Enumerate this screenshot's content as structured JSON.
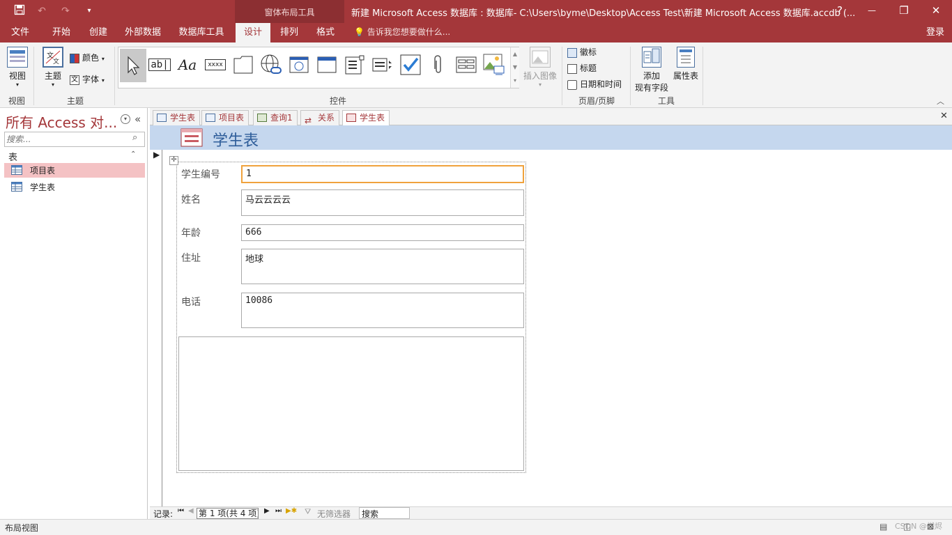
{
  "window": {
    "title": "新建 Microsoft Access 数据库 : 数据库- C:\\Users\\byme\\Desktop\\Access Test\\新建 Microsoft Access 数据库.accdb (...",
    "context_group": "窗体布局工具",
    "help": "?",
    "login": "登录",
    "minimize": "—",
    "restore": "❐",
    "close": "✕"
  },
  "ribbon_tabs": [
    "文件",
    "开始",
    "创建",
    "外部数据",
    "数据库工具",
    "设计",
    "排列",
    "格式"
  ],
  "tellme": "告诉我您想要做什么...",
  "ribbon": {
    "view_label": "视图",
    "view_group": "视图",
    "theme_label": "主题",
    "colors_label": "颜色",
    "fonts_label": "字体",
    "theme_group": "主题",
    "controls_group": "控件",
    "insert_image": "插入图像",
    "logo": "徽标",
    "title": "标题",
    "datetime": "日期和时间",
    "header_footer_group": "页眉/页脚",
    "add_fields_1": "添加",
    "add_fields_2": "现有字段",
    "property_sheet": "属性表",
    "tools_group": "工具",
    "gallery_text_ab": "ab|",
    "gallery_text_aa": "Aa",
    "gallery_text_xxxx": "xxxx"
  },
  "nav": {
    "title": "所有 Access 对...",
    "search_placeholder": "搜索...",
    "section": "表",
    "items": [
      "项目表",
      "学生表"
    ]
  },
  "doc_tabs": [
    "学生表",
    "项目表",
    "查询1",
    "关系",
    "学生表"
  ],
  "form": {
    "title": "学生表",
    "fields": [
      {
        "label": "学生编号",
        "value": "1"
      },
      {
        "label": "姓名",
        "value": "马云云云云"
      },
      {
        "label": "年龄",
        "value": "666"
      },
      {
        "label": "住址",
        "value": "地球"
      },
      {
        "label": "电话",
        "value": "10086"
      }
    ]
  },
  "record_nav": {
    "label": "记录:",
    "position": "第 1 项(共 4 项)",
    "filter": "无筛选器",
    "search": "搜索"
  },
  "status": {
    "mode": "布局视图",
    "watermark": "CSDN @燃烬"
  },
  "colors": {
    "accent": "#a4373a",
    "form_header": "#c5d7ee",
    "focus": "#f0a23c"
  }
}
